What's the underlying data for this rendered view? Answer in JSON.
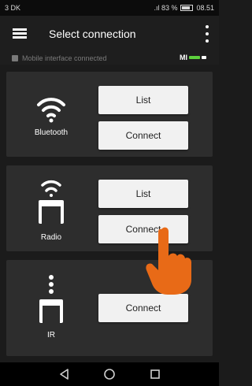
{
  "status_bar": {
    "left_text": "3 DK",
    "right_text": ".ıl 83 %",
    "time": "08.51"
  },
  "app_bar": {
    "title": "Select connection"
  },
  "interface_status": {
    "label": "Mobile interface connected",
    "logo_text": "MI"
  },
  "connections": [
    {
      "name": "Bluetooth",
      "icon": "bluetooth-wifi-icon",
      "list_label": "List",
      "connect_label": "Connect"
    },
    {
      "name": "Radio",
      "icon": "radio-module-icon",
      "list_label": "List",
      "connect_label": "Connect"
    },
    {
      "name": "IR",
      "icon": "ir-module-icon",
      "connect_label": "Connect"
    }
  ],
  "nav": {
    "icons": [
      "back-icon",
      "home-icon",
      "recents-icon"
    ]
  },
  "colors": {
    "background": "#1b1b1b",
    "card": "#2d2d2d",
    "button": "#f1f1f1",
    "hand_cursor": "#e86a17",
    "mi_green": "#5dd13d"
  }
}
